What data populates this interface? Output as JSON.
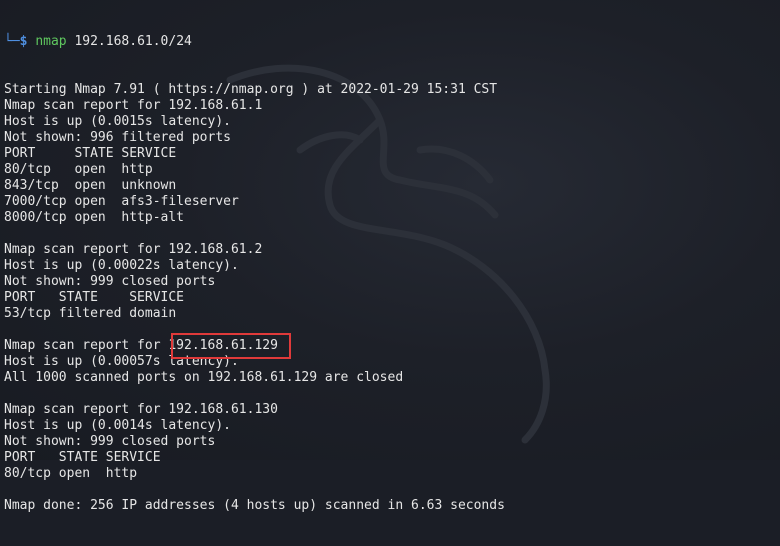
{
  "prompt": {
    "corner": "└─",
    "symbol": "$",
    "command": "nmap",
    "args": "192.168.61.0/24"
  },
  "output_lines": [
    "Starting Nmap 7.91 ( https://nmap.org ) at 2022-01-29 15:31 CST",
    "Nmap scan report for 192.168.61.1",
    "Host is up (0.0015s latency).",
    "Not shown: 996 filtered ports",
    "PORT     STATE SERVICE",
    "80/tcp   open  http",
    "843/tcp  open  unknown",
    "7000/tcp open  afs3-fileserver",
    "8000/tcp open  http-alt",
    "",
    "Nmap scan report for 192.168.61.2",
    "Host is up (0.00022s latency).",
    "Not shown: 999 closed ports",
    "PORT   STATE    SERVICE",
    "53/tcp filtered domain",
    "",
    "Nmap scan report for 192.168.61.129",
    "Host is up (0.00057s latency).",
    "All 1000 scanned ports on 192.168.61.129 are closed",
    "",
    "Nmap scan report for 192.168.61.130",
    "Host is up (0.0014s latency).",
    "Not shown: 999 closed ports",
    "PORT   STATE SERVICE",
    "80/tcp open  http",
    "",
    "Nmap done: 256 IP addresses (4 hosts up) scanned in 6.63 seconds"
  ],
  "highlight_color": "#e03a3a",
  "colors": {
    "background": "#1b1e26",
    "text": "#e6e6e6",
    "prompt": "#4f8fe0",
    "command": "#5fc85f"
  }
}
